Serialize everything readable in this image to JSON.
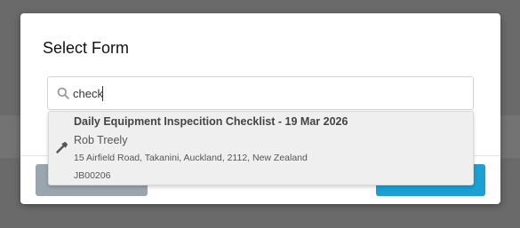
{
  "dialog": {
    "title": "Select Form"
  },
  "search": {
    "value": "check",
    "icon": "search-icon"
  },
  "results": [
    {
      "icon": "hammer-icon",
      "title": "Daily Equipment Inspecition Checklist - 19 Mar 2026",
      "person": "Rob Treely",
      "address": "15 Airfield Road, Takanini, Auckland, 2112, New Zealand",
      "code": "JB00206"
    }
  ],
  "colors": {
    "backdrop": "#6a6a6a",
    "secondary_button": "#9aa6ad",
    "primary_button": "#1aa0d2",
    "result_background": "#efefef"
  }
}
